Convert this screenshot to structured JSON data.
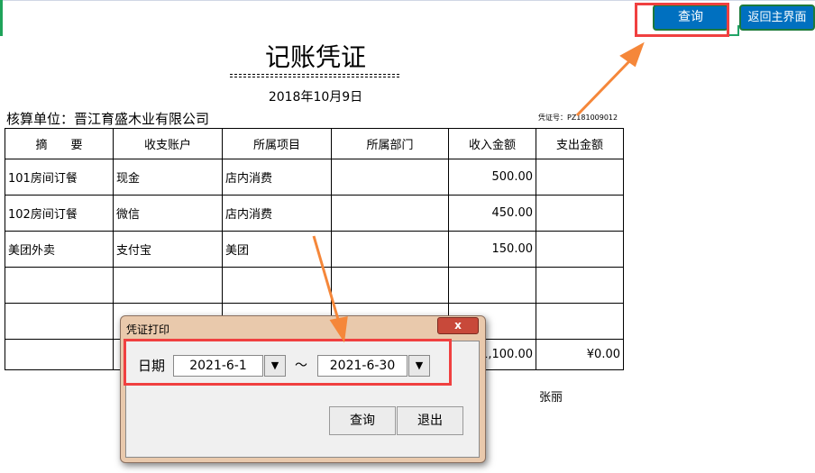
{
  "header": {
    "query_label": "查询",
    "back_label": "返回主界面"
  },
  "voucher": {
    "title": "记账凭证",
    "date": "2018年10月9日",
    "unit": "核算单位：晋江育盛木业有限公司",
    "number": "凭证号：PZ181009012",
    "columns": [
      "摘　　要",
      "收支账户",
      "所属项目",
      "所属部门",
      "收入金额",
      "支出金额"
    ],
    "rows": [
      [
        "101房间订餐",
        "现金",
        "店内消费",
        "",
        "500.00",
        ""
      ],
      [
        "102房间订餐",
        "微信",
        "店内消费",
        "",
        "450.00",
        ""
      ],
      [
        "美团外卖",
        "支付宝",
        "美团",
        "",
        "150.00",
        ""
      ],
      [
        "",
        "",
        "",
        "",
        "",
        ""
      ],
      [
        "",
        "",
        "",
        "",
        "",
        ""
      ]
    ],
    "total_in": "¥1,100.00",
    "total_out": "¥0.00",
    "signer": "张丽"
  },
  "dialog": {
    "title": "凭证打印",
    "date_label": "日期",
    "start": "2021-6-1",
    "end": "2021-6-30",
    "sep": "～",
    "query": "查询",
    "exit": "退出",
    "close": "x"
  }
}
